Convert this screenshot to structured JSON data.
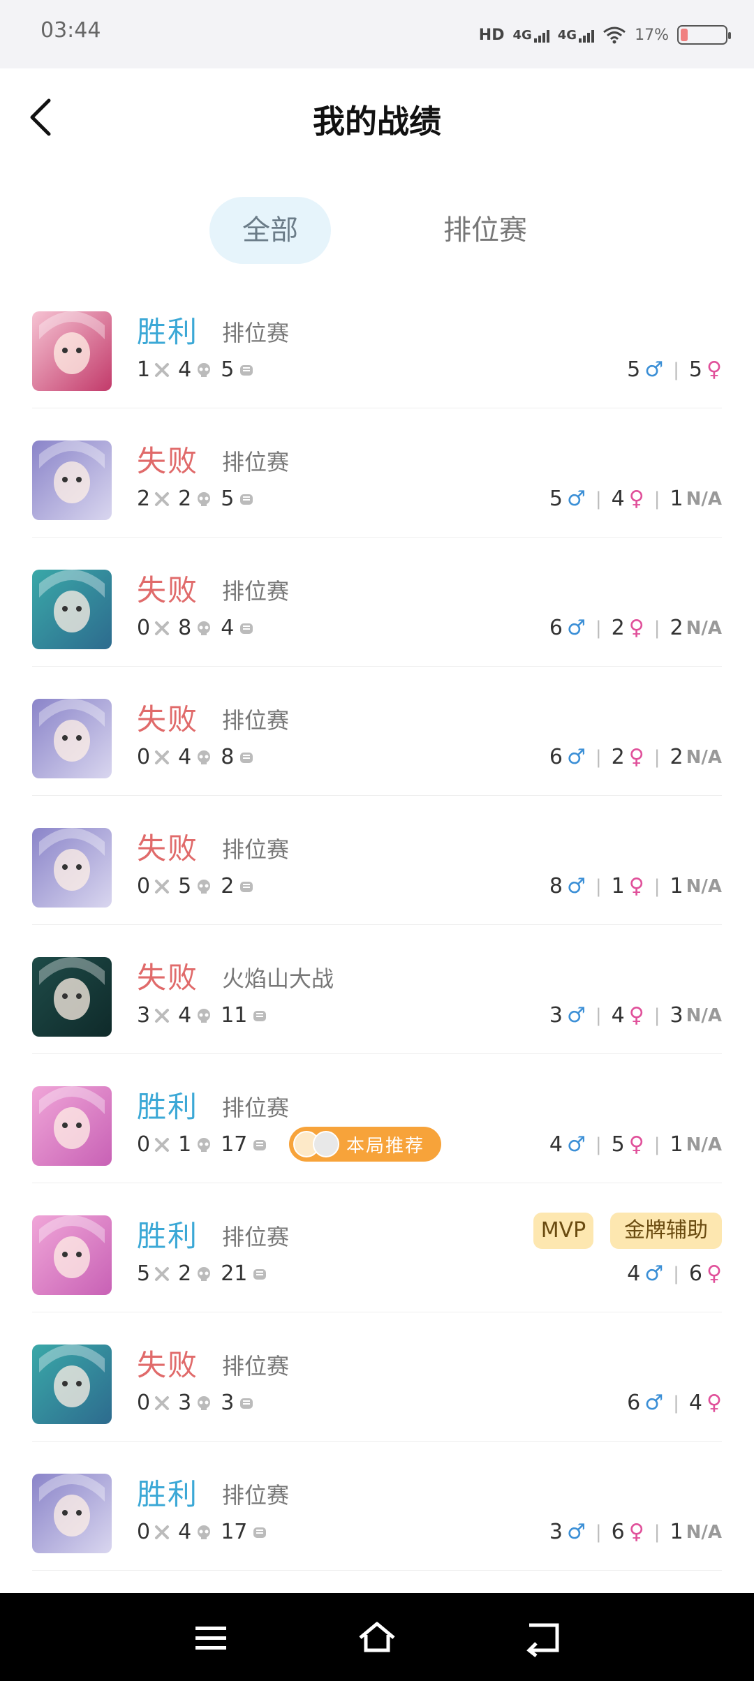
{
  "status_bar": {
    "time": "03:44",
    "hd": "HD",
    "net1": "4G",
    "net2": "4G",
    "battery": "17%"
  },
  "header": {
    "title": "我的战绩"
  },
  "tabs": [
    {
      "label": "全部",
      "active": true
    },
    {
      "label": "排位赛",
      "active": false
    }
  ],
  "matches": [
    {
      "result": "胜利",
      "win": true,
      "mode": "排位赛",
      "kills": "1",
      "deaths": "4",
      "assists": "5",
      "male": "5",
      "female": "5",
      "na": null,
      "avatar_colors": [
        "#f6c3d3",
        "#c23a6a"
      ]
    },
    {
      "result": "失败",
      "win": false,
      "mode": "排位赛",
      "kills": "2",
      "deaths": "2",
      "assists": "5",
      "male": "5",
      "female": "4",
      "na": "1",
      "avatar_colors": [
        "#8a84c9",
        "#d9d6ef"
      ]
    },
    {
      "result": "失败",
      "win": false,
      "mode": "排位赛",
      "kills": "0",
      "deaths": "8",
      "assists": "4",
      "male": "6",
      "female": "2",
      "na": "2",
      "avatar_colors": [
        "#3aa8a8",
        "#2d6b8e"
      ]
    },
    {
      "result": "失败",
      "win": false,
      "mode": "排位赛",
      "kills": "0",
      "deaths": "4",
      "assists": "8",
      "male": "6",
      "female": "2",
      "na": "2",
      "avatar_colors": [
        "#8a84c9",
        "#d9d6ef"
      ]
    },
    {
      "result": "失败",
      "win": false,
      "mode": "排位赛",
      "kills": "0",
      "deaths": "5",
      "assists": "2",
      "male": "8",
      "female": "1",
      "na": "1",
      "avatar_colors": [
        "#8a84c9",
        "#d9d6ef"
      ]
    },
    {
      "result": "失败",
      "win": false,
      "mode": "火焰山大战",
      "kills": "3",
      "deaths": "4",
      "assists": "11",
      "male": "3",
      "female": "4",
      "na": "3",
      "avatar_colors": [
        "#1e4b48",
        "#0f2a2a"
      ]
    },
    {
      "result": "胜利",
      "win": true,
      "mode": "排位赛",
      "kills": "0",
      "deaths": "1",
      "assists": "17",
      "male": "4",
      "female": "5",
      "na": "1",
      "recommend": "本局推荐",
      "avatar_colors": [
        "#f0a6d8",
        "#c861b5"
      ]
    },
    {
      "result": "胜利",
      "win": true,
      "mode": "排位赛",
      "kills": "5",
      "deaths": "2",
      "assists": "21",
      "male": "4",
      "female": "6",
      "na": null,
      "badges": [
        "MVP",
        "金牌辅助"
      ],
      "avatar_colors": [
        "#f0a6d8",
        "#c861b5"
      ]
    },
    {
      "result": "失败",
      "win": false,
      "mode": "排位赛",
      "kills": "0",
      "deaths": "3",
      "assists": "3",
      "male": "6",
      "female": "4",
      "na": null,
      "avatar_colors": [
        "#3aa8a8",
        "#2d6b8e"
      ]
    },
    {
      "result": "胜利",
      "win": true,
      "mode": "排位赛",
      "kills": "0",
      "deaths": "4",
      "assists": "17",
      "male": "3",
      "female": "6",
      "na": "1",
      "avatar_colors": [
        "#8a84c9",
        "#d9d6ef"
      ]
    }
  ],
  "labels": {
    "na": "N/A",
    "male_symbol": "♂",
    "female_symbol": "♀"
  },
  "navbar": {
    "icons": [
      "menu-icon",
      "home-icon",
      "back-icon"
    ]
  }
}
